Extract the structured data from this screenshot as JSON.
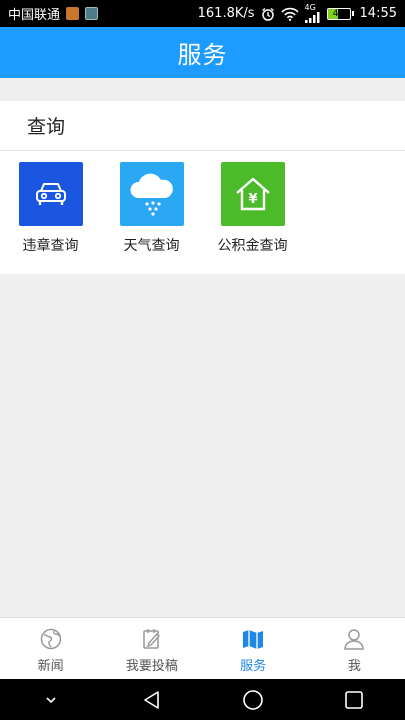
{
  "status_bar": {
    "carrier": "中国联通",
    "speed": "161.8K/s",
    "network_type": "4G",
    "battery_level": "47",
    "time": "14:55"
  },
  "header": {
    "title": "服务"
  },
  "section": {
    "title": "查询",
    "items": [
      {
        "label": "违章查询",
        "icon": "car-icon",
        "color": "#1a56e0"
      },
      {
        "label": "天气查询",
        "icon": "weather-cloud-rain-icon",
        "color": "#2aa8f3"
      },
      {
        "label": "公积金查询",
        "icon": "house-yuan-icon",
        "color": "#4cbb2a"
      }
    ]
  },
  "tabbar": {
    "active_color": "#1e88e5",
    "tabs": [
      {
        "label": "新闻",
        "icon": "globe-icon"
      },
      {
        "label": "我要投稿",
        "icon": "edit-note-icon"
      },
      {
        "label": "服务",
        "icon": "map-icon",
        "active": true
      },
      {
        "label": "我",
        "icon": "person-icon"
      }
    ]
  }
}
